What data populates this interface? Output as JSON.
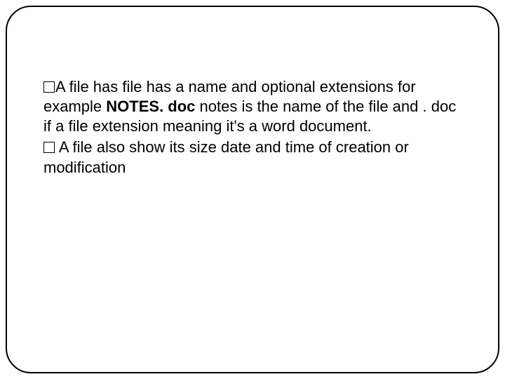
{
  "slide": {
    "items": [
      {
        "first_before_bold": "A file has file has a name and optional extensions for example ",
        "bold": "NOTES. doc",
        "first_after_bold": " notes is the name of the file and . doc if a file extension meaning it's a word document."
      },
      {
        "text": "   A file also show its size date and time of creation or modification"
      }
    ]
  }
}
